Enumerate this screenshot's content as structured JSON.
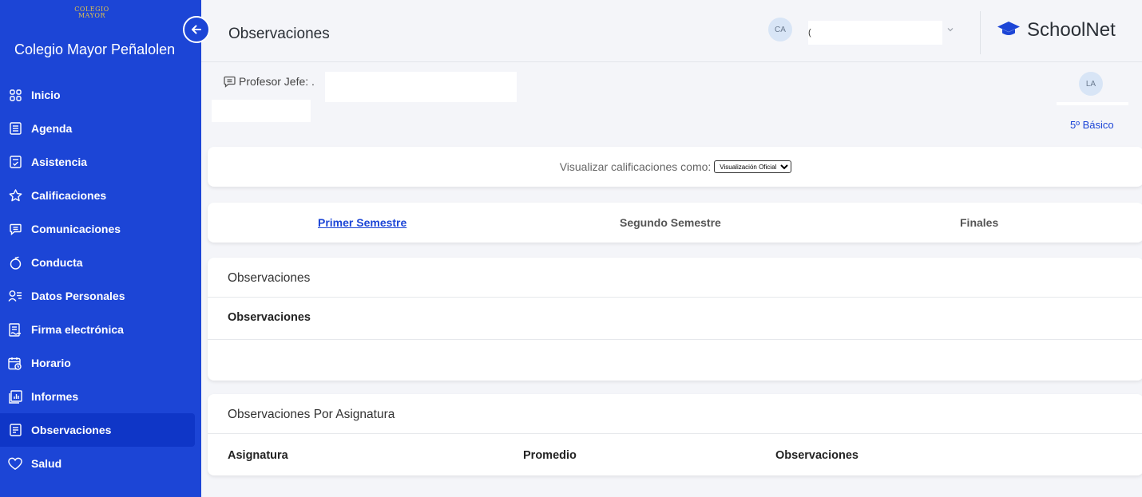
{
  "sidebar": {
    "logo_line1": "COLEGIO",
    "logo_line2": "MAYOR",
    "school_name": "Colegio Mayor Peñalolen",
    "items": [
      {
        "label": "Inicio",
        "icon": "grid-icon"
      },
      {
        "label": "Agenda",
        "icon": "agenda-icon"
      },
      {
        "label": "Asistencia",
        "icon": "attendance-icon"
      },
      {
        "label": "Calificaciones",
        "icon": "star-icon"
      },
      {
        "label": "Comunicaciones",
        "icon": "message-icon"
      },
      {
        "label": "Conducta",
        "icon": "apple-icon"
      },
      {
        "label": "Datos Personales",
        "icon": "user-list-icon"
      },
      {
        "label": "Firma electrónica",
        "icon": "signature-icon"
      },
      {
        "label": "Horario",
        "icon": "calendar-clock-icon"
      },
      {
        "label": "Informes",
        "icon": "report-icon"
      },
      {
        "label": "Observaciones",
        "icon": "notes-icon",
        "active": true
      },
      {
        "label": "Salud",
        "icon": "heart-icon"
      }
    ]
  },
  "header": {
    "title": "Observaciones",
    "user_initials": "CA",
    "user_name": "(",
    "brand": "SchoolNet"
  },
  "info": {
    "teacher_label": "Profesor Jefe: .",
    "student_initials": "LA",
    "course": "5º Básico"
  },
  "view": {
    "label": "Visualizar calificaciones como:",
    "selected": "Visualización Oficial"
  },
  "tabs": [
    {
      "label": "Primer Semestre",
      "active": true
    },
    {
      "label": "Segundo Semestre",
      "active": false
    },
    {
      "label": "Finales",
      "active": false
    }
  ],
  "observaciones": {
    "title": "Observaciones",
    "column": "Observaciones"
  },
  "por_asignatura": {
    "title": "Observaciones Por Asignatura",
    "columns": [
      "Asignatura",
      "Promedio",
      "Observaciones"
    ]
  },
  "colors": {
    "sidebar": "#1c45d6",
    "accent": "#1c45d6",
    "logo_gold": "#e2c24a"
  }
}
